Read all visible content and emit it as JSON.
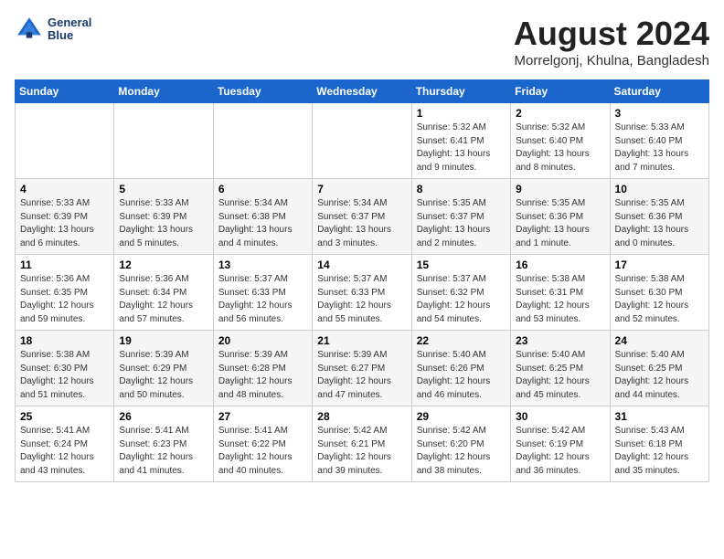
{
  "header": {
    "logo_line1": "General",
    "logo_line2": "Blue",
    "month_title": "August 2024",
    "location": "Morrelgonj, Khulna, Bangladesh"
  },
  "weekdays": [
    "Sunday",
    "Monday",
    "Tuesday",
    "Wednesday",
    "Thursday",
    "Friday",
    "Saturday"
  ],
  "weeks": [
    [
      {
        "day": "",
        "info": ""
      },
      {
        "day": "",
        "info": ""
      },
      {
        "day": "",
        "info": ""
      },
      {
        "day": "",
        "info": ""
      },
      {
        "day": "1",
        "info": "Sunrise: 5:32 AM\nSunset: 6:41 PM\nDaylight: 13 hours\nand 9 minutes."
      },
      {
        "day": "2",
        "info": "Sunrise: 5:32 AM\nSunset: 6:40 PM\nDaylight: 13 hours\nand 8 minutes."
      },
      {
        "day": "3",
        "info": "Sunrise: 5:33 AM\nSunset: 6:40 PM\nDaylight: 13 hours\nand 7 minutes."
      }
    ],
    [
      {
        "day": "4",
        "info": "Sunrise: 5:33 AM\nSunset: 6:39 PM\nDaylight: 13 hours\nand 6 minutes."
      },
      {
        "day": "5",
        "info": "Sunrise: 5:33 AM\nSunset: 6:39 PM\nDaylight: 13 hours\nand 5 minutes."
      },
      {
        "day": "6",
        "info": "Sunrise: 5:34 AM\nSunset: 6:38 PM\nDaylight: 13 hours\nand 4 minutes."
      },
      {
        "day": "7",
        "info": "Sunrise: 5:34 AM\nSunset: 6:37 PM\nDaylight: 13 hours\nand 3 minutes."
      },
      {
        "day": "8",
        "info": "Sunrise: 5:35 AM\nSunset: 6:37 PM\nDaylight: 13 hours\nand 2 minutes."
      },
      {
        "day": "9",
        "info": "Sunrise: 5:35 AM\nSunset: 6:36 PM\nDaylight: 13 hours\nand 1 minute."
      },
      {
        "day": "10",
        "info": "Sunrise: 5:35 AM\nSunset: 6:36 PM\nDaylight: 13 hours\nand 0 minutes."
      }
    ],
    [
      {
        "day": "11",
        "info": "Sunrise: 5:36 AM\nSunset: 6:35 PM\nDaylight: 12 hours\nand 59 minutes."
      },
      {
        "day": "12",
        "info": "Sunrise: 5:36 AM\nSunset: 6:34 PM\nDaylight: 12 hours\nand 57 minutes."
      },
      {
        "day": "13",
        "info": "Sunrise: 5:37 AM\nSunset: 6:33 PM\nDaylight: 12 hours\nand 56 minutes."
      },
      {
        "day": "14",
        "info": "Sunrise: 5:37 AM\nSunset: 6:33 PM\nDaylight: 12 hours\nand 55 minutes."
      },
      {
        "day": "15",
        "info": "Sunrise: 5:37 AM\nSunset: 6:32 PM\nDaylight: 12 hours\nand 54 minutes."
      },
      {
        "day": "16",
        "info": "Sunrise: 5:38 AM\nSunset: 6:31 PM\nDaylight: 12 hours\nand 53 minutes."
      },
      {
        "day": "17",
        "info": "Sunrise: 5:38 AM\nSunset: 6:30 PM\nDaylight: 12 hours\nand 52 minutes."
      }
    ],
    [
      {
        "day": "18",
        "info": "Sunrise: 5:38 AM\nSunset: 6:30 PM\nDaylight: 12 hours\nand 51 minutes."
      },
      {
        "day": "19",
        "info": "Sunrise: 5:39 AM\nSunset: 6:29 PM\nDaylight: 12 hours\nand 50 minutes."
      },
      {
        "day": "20",
        "info": "Sunrise: 5:39 AM\nSunset: 6:28 PM\nDaylight: 12 hours\nand 48 minutes."
      },
      {
        "day": "21",
        "info": "Sunrise: 5:39 AM\nSunset: 6:27 PM\nDaylight: 12 hours\nand 47 minutes."
      },
      {
        "day": "22",
        "info": "Sunrise: 5:40 AM\nSunset: 6:26 PM\nDaylight: 12 hours\nand 46 minutes."
      },
      {
        "day": "23",
        "info": "Sunrise: 5:40 AM\nSunset: 6:25 PM\nDaylight: 12 hours\nand 45 minutes."
      },
      {
        "day": "24",
        "info": "Sunrise: 5:40 AM\nSunset: 6:25 PM\nDaylight: 12 hours\nand 44 minutes."
      }
    ],
    [
      {
        "day": "25",
        "info": "Sunrise: 5:41 AM\nSunset: 6:24 PM\nDaylight: 12 hours\nand 43 minutes."
      },
      {
        "day": "26",
        "info": "Sunrise: 5:41 AM\nSunset: 6:23 PM\nDaylight: 12 hours\nand 41 minutes."
      },
      {
        "day": "27",
        "info": "Sunrise: 5:41 AM\nSunset: 6:22 PM\nDaylight: 12 hours\nand 40 minutes."
      },
      {
        "day": "28",
        "info": "Sunrise: 5:42 AM\nSunset: 6:21 PM\nDaylight: 12 hours\nand 39 minutes."
      },
      {
        "day": "29",
        "info": "Sunrise: 5:42 AM\nSunset: 6:20 PM\nDaylight: 12 hours\nand 38 minutes."
      },
      {
        "day": "30",
        "info": "Sunrise: 5:42 AM\nSunset: 6:19 PM\nDaylight: 12 hours\nand 36 minutes."
      },
      {
        "day": "31",
        "info": "Sunrise: 5:43 AM\nSunset: 6:18 PM\nDaylight: 12 hours\nand 35 minutes."
      }
    ]
  ]
}
